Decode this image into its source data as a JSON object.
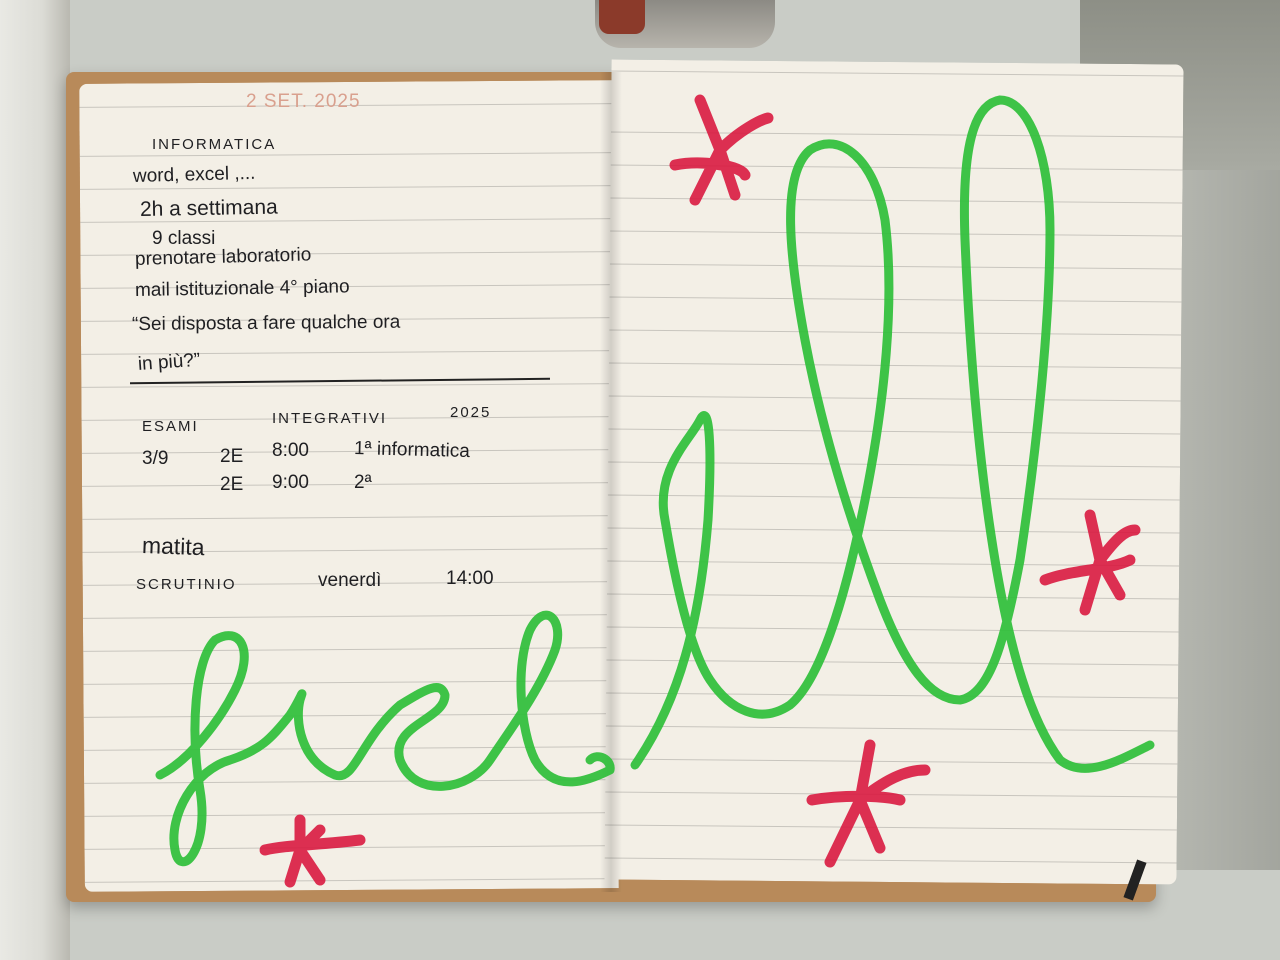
{
  "stamp": "2 SET. 2025",
  "left_page": {
    "lines": [
      {
        "text": "INFORMATICA"
      },
      {
        "text": "word, excel ,..."
      },
      {
        "text": "2h   a settimana"
      },
      {
        "text": "9 classi"
      },
      {
        "text": "prenotare laboratorio"
      },
      {
        "text": "mail  istituzionale  4° piano"
      },
      {
        "text": "“Sei disposta a fare qualche ora"
      },
      {
        "text": "in più?”"
      }
    ],
    "exam_header": {
      "col1": "ESAMI",
      "col2": "INTEGRATIVI",
      "col3": "2025"
    },
    "exam_rows": [
      {
        "date": "3/9",
        "room": "2E",
        "time": "8:00",
        "subject": "1ª informatica"
      },
      {
        "date": "",
        "room": "2E",
        "time": "9:00",
        "subject": "2ª"
      }
    ],
    "note": "matita",
    "scrutinio": {
      "label": "SCRUTINIO",
      "day": "venerdì",
      "time": "14:00"
    }
  },
  "doodles": {
    "green": "#2fbf3a",
    "red": "#d8143c"
  }
}
